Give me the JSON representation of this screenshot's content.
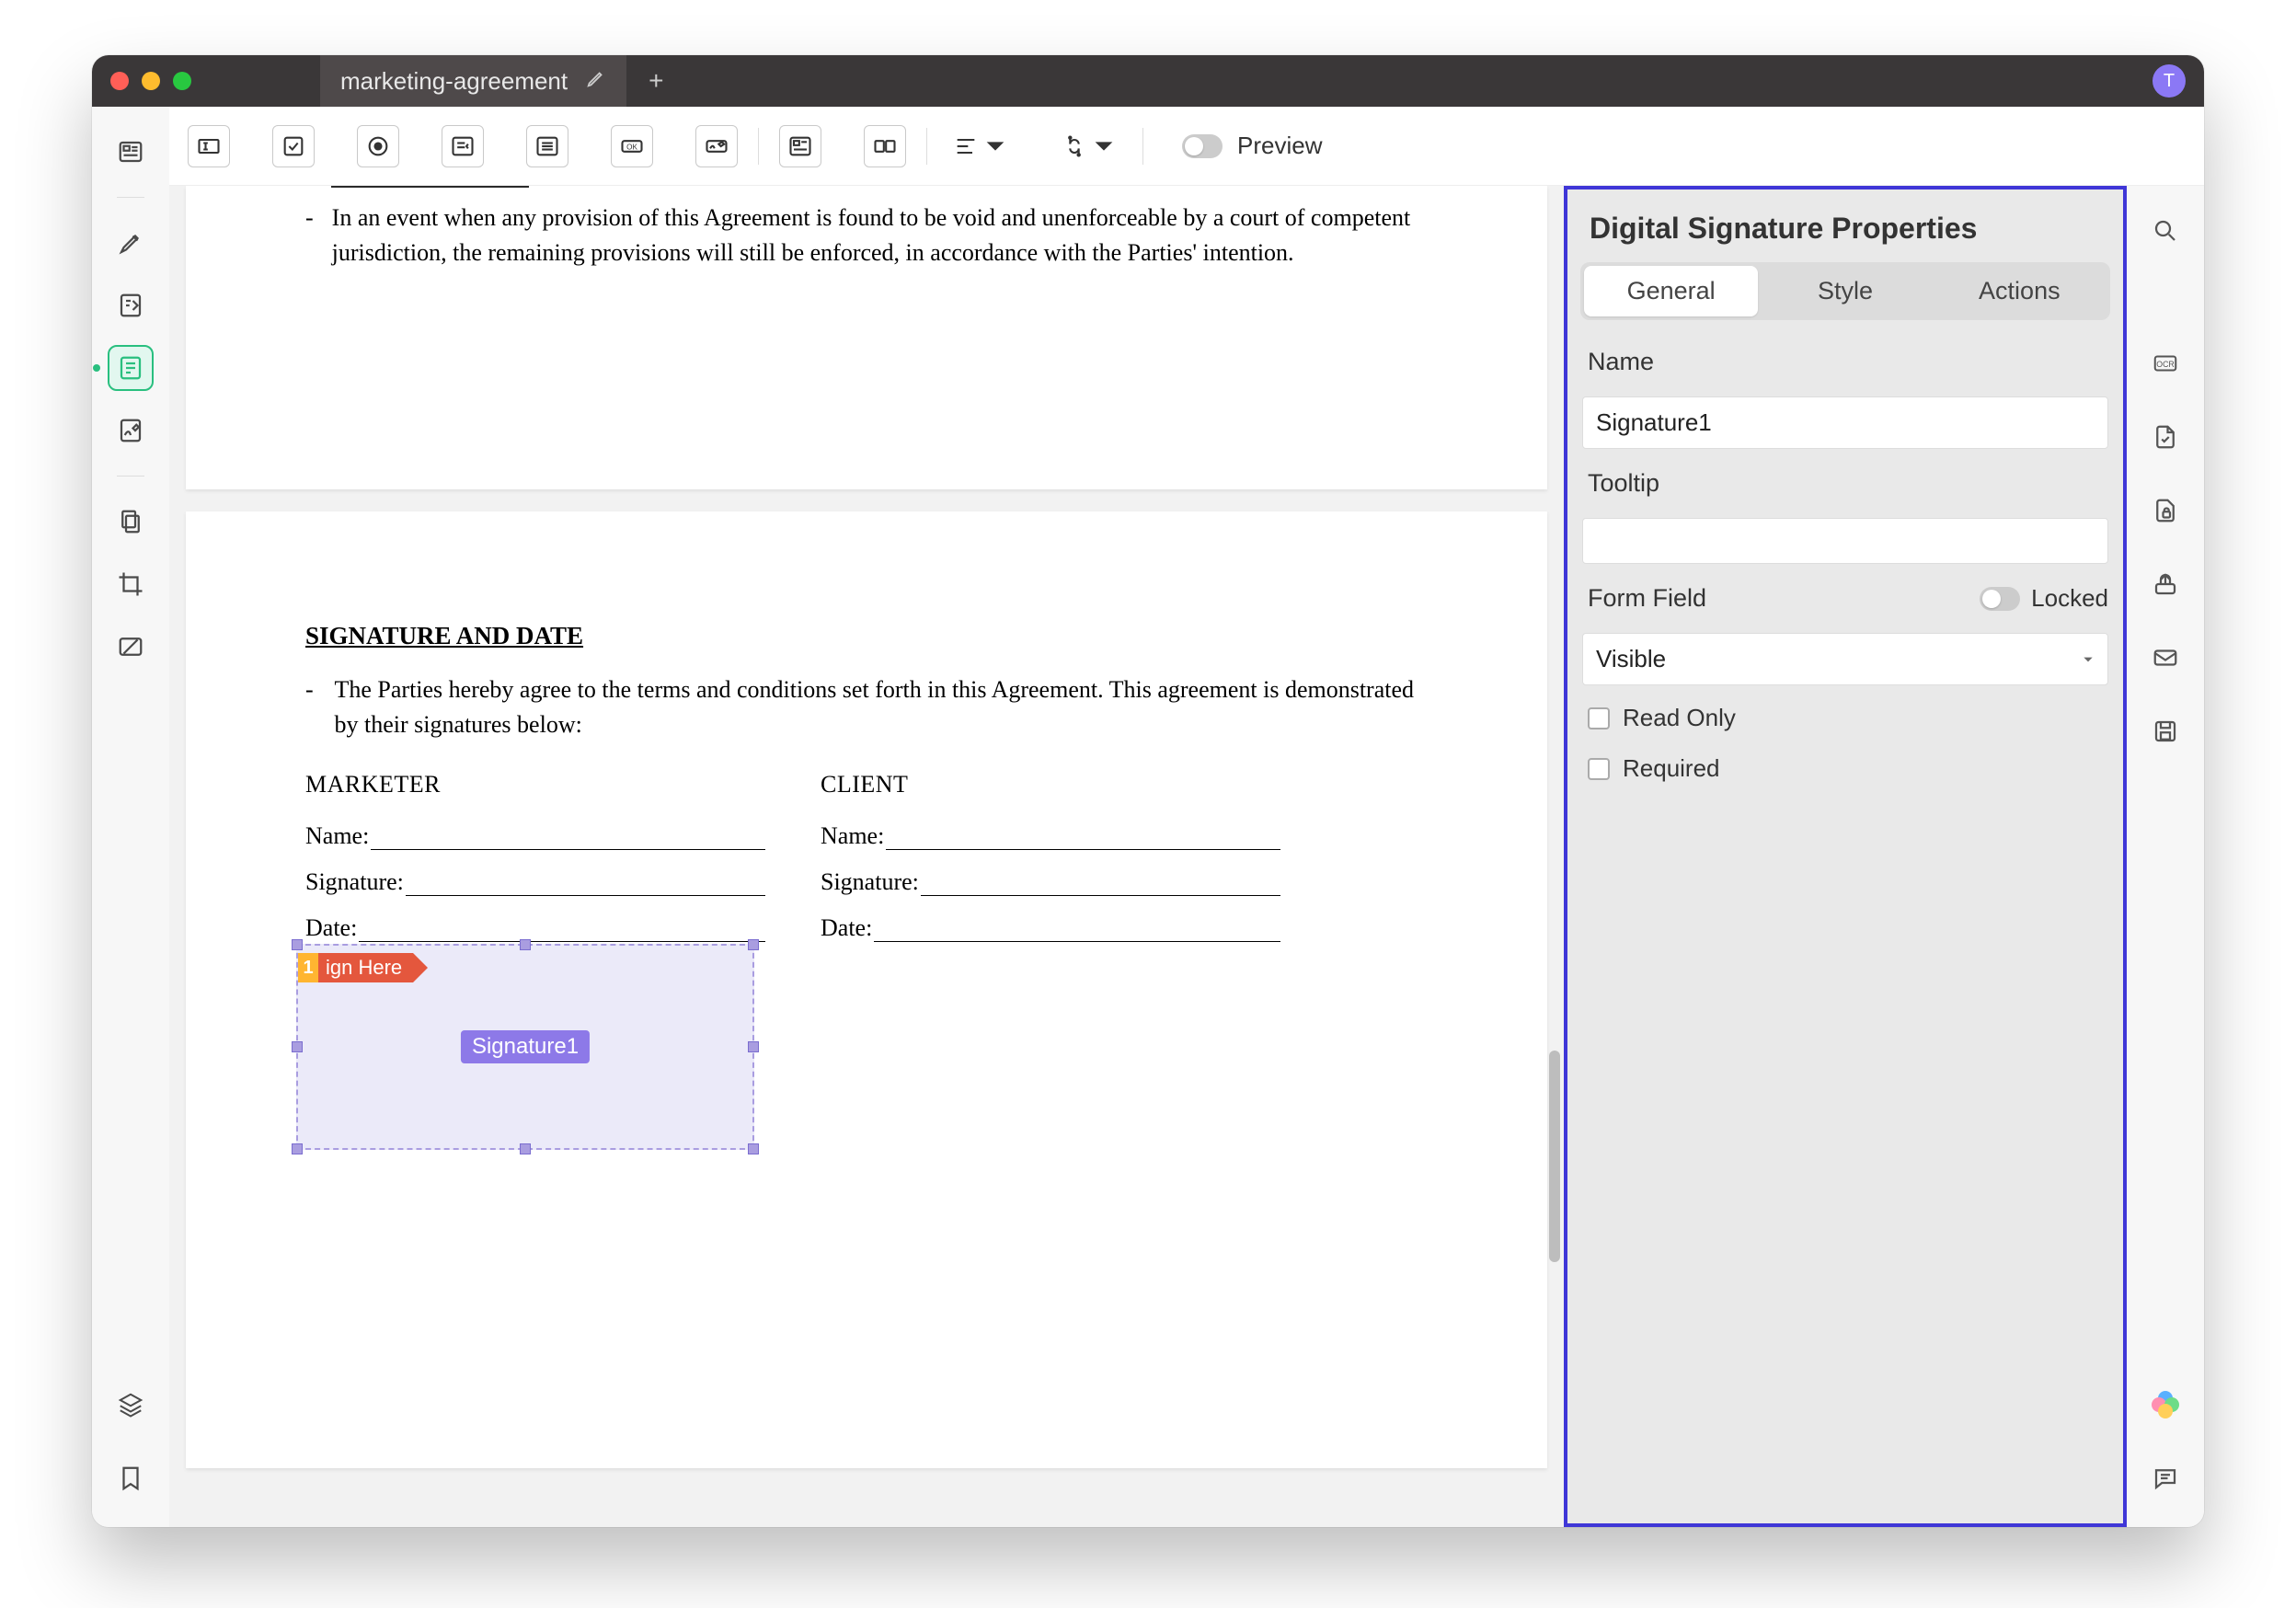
{
  "titlebar": {
    "tab_title": "marketing-agreement",
    "avatar_letter": "T"
  },
  "toolbar": {
    "preview_label": "Preview"
  },
  "document": {
    "prev_page_text": "In an event when any provision of this Agreement is found to be void and unenforceable by a court of competent jurisdiction, the remaining provisions will still be enforced, in accordance with the Parties' intention.",
    "section_title": "SIGNATURE AND DATE",
    "section_text": "The Parties hereby agree to the terms and conditions set forth in this Agreement. This agreement is demonstrated by their signatures below:",
    "col1_head": "MARKETER",
    "col2_head": "CLIENT",
    "name_label": "Name:",
    "sig_label_text": "Signature:",
    "date_label": "Date:",
    "sign_here_num": "1",
    "sign_here_text": "ign Here",
    "sig_field_label": "Signature1"
  },
  "properties": {
    "title": "Digital Signature Properties",
    "tabs": {
      "general": "General",
      "style": "Style",
      "actions": "Actions"
    },
    "name_label": "Name",
    "name_value": "Signature1",
    "tooltip_label": "Tooltip",
    "tooltip_value": "",
    "formfield_label": "Form Field",
    "locked_label": "Locked",
    "visibility_value": "Visible",
    "readonly_label": "Read Only",
    "required_label": "Required"
  }
}
